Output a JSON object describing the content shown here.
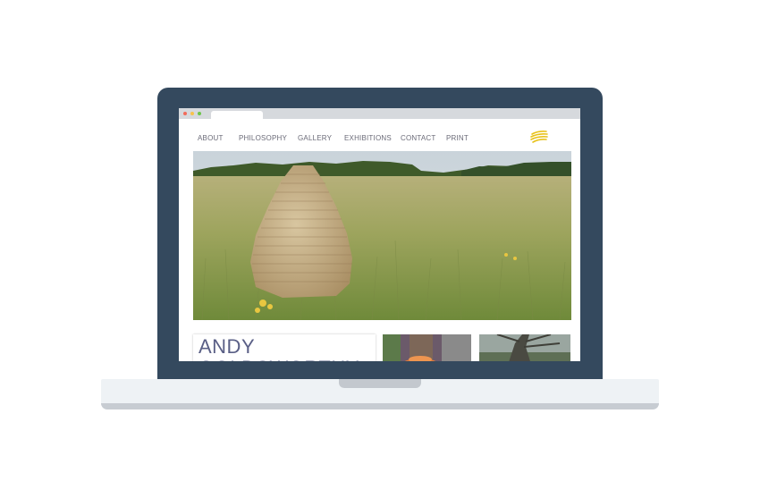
{
  "nav": {
    "items": [
      {
        "label": "ABOUT"
      },
      {
        "label": "PHILOSOPHY"
      },
      {
        "label": "GALLERY"
      },
      {
        "label": "EXHIBITIONS"
      },
      {
        "label": "CONTACT"
      },
      {
        "label": "PRINT"
      }
    ]
  },
  "feature": {
    "name": "ANDY\nGOLDSWORTHY"
  },
  "colors": {
    "laptop_frame": "#34495e",
    "nav_text": "#6b6b78",
    "name_text": "#5a5f86",
    "logo_accent": "#e8c21a"
  },
  "icons": {
    "logo": "yellow-stripes-logo"
  }
}
